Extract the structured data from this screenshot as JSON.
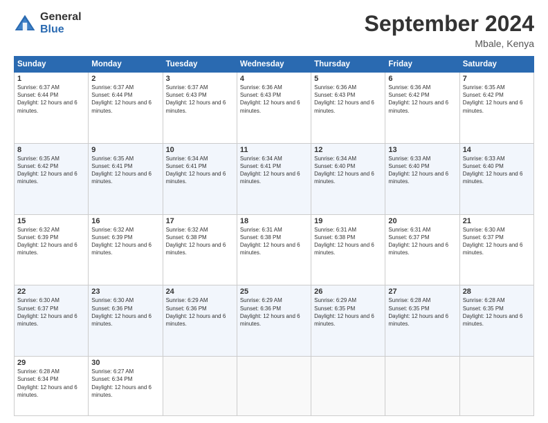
{
  "header": {
    "logo_general": "General",
    "logo_blue": "Blue",
    "month_title": "September 2024",
    "location": "Mbale, Kenya"
  },
  "days_of_week": [
    "Sunday",
    "Monday",
    "Tuesday",
    "Wednesday",
    "Thursday",
    "Friday",
    "Saturday"
  ],
  "weeks": [
    [
      {
        "day": "1",
        "sunrise": "6:37 AM",
        "sunset": "6:44 PM",
        "daylight": "12 hours and 6 minutes."
      },
      {
        "day": "2",
        "sunrise": "6:37 AM",
        "sunset": "6:44 PM",
        "daylight": "12 hours and 6 minutes."
      },
      {
        "day": "3",
        "sunrise": "6:37 AM",
        "sunset": "6:43 PM",
        "daylight": "12 hours and 6 minutes."
      },
      {
        "day": "4",
        "sunrise": "6:36 AM",
        "sunset": "6:43 PM",
        "daylight": "12 hours and 6 minutes."
      },
      {
        "day": "5",
        "sunrise": "6:36 AM",
        "sunset": "6:43 PM",
        "daylight": "12 hours and 6 minutes."
      },
      {
        "day": "6",
        "sunrise": "6:36 AM",
        "sunset": "6:42 PM",
        "daylight": "12 hours and 6 minutes."
      },
      {
        "day": "7",
        "sunrise": "6:35 AM",
        "sunset": "6:42 PM",
        "daylight": "12 hours and 6 minutes."
      }
    ],
    [
      {
        "day": "8",
        "sunrise": "6:35 AM",
        "sunset": "6:42 PM",
        "daylight": "12 hours and 6 minutes."
      },
      {
        "day": "9",
        "sunrise": "6:35 AM",
        "sunset": "6:41 PM",
        "daylight": "12 hours and 6 minutes."
      },
      {
        "day": "10",
        "sunrise": "6:34 AM",
        "sunset": "6:41 PM",
        "daylight": "12 hours and 6 minutes."
      },
      {
        "day": "11",
        "sunrise": "6:34 AM",
        "sunset": "6:41 PM",
        "daylight": "12 hours and 6 minutes."
      },
      {
        "day": "12",
        "sunrise": "6:34 AM",
        "sunset": "6:40 PM",
        "daylight": "12 hours and 6 minutes."
      },
      {
        "day": "13",
        "sunrise": "6:33 AM",
        "sunset": "6:40 PM",
        "daylight": "12 hours and 6 minutes."
      },
      {
        "day": "14",
        "sunrise": "6:33 AM",
        "sunset": "6:40 PM",
        "daylight": "12 hours and 6 minutes."
      }
    ],
    [
      {
        "day": "15",
        "sunrise": "6:32 AM",
        "sunset": "6:39 PM",
        "daylight": "12 hours and 6 minutes."
      },
      {
        "day": "16",
        "sunrise": "6:32 AM",
        "sunset": "6:39 PM",
        "daylight": "12 hours and 6 minutes."
      },
      {
        "day": "17",
        "sunrise": "6:32 AM",
        "sunset": "6:38 PM",
        "daylight": "12 hours and 6 minutes."
      },
      {
        "day": "18",
        "sunrise": "6:31 AM",
        "sunset": "6:38 PM",
        "daylight": "12 hours and 6 minutes."
      },
      {
        "day": "19",
        "sunrise": "6:31 AM",
        "sunset": "6:38 PM",
        "daylight": "12 hours and 6 minutes."
      },
      {
        "day": "20",
        "sunrise": "6:31 AM",
        "sunset": "6:37 PM",
        "daylight": "12 hours and 6 minutes."
      },
      {
        "day": "21",
        "sunrise": "6:30 AM",
        "sunset": "6:37 PM",
        "daylight": "12 hours and 6 minutes."
      }
    ],
    [
      {
        "day": "22",
        "sunrise": "6:30 AM",
        "sunset": "6:37 PM",
        "daylight": "12 hours and 6 minutes."
      },
      {
        "day": "23",
        "sunrise": "6:30 AM",
        "sunset": "6:36 PM",
        "daylight": "12 hours and 6 minutes."
      },
      {
        "day": "24",
        "sunrise": "6:29 AM",
        "sunset": "6:36 PM",
        "daylight": "12 hours and 6 minutes."
      },
      {
        "day": "25",
        "sunrise": "6:29 AM",
        "sunset": "6:36 PM",
        "daylight": "12 hours and 6 minutes."
      },
      {
        "day": "26",
        "sunrise": "6:29 AM",
        "sunset": "6:35 PM",
        "daylight": "12 hours and 6 minutes."
      },
      {
        "day": "27",
        "sunrise": "6:28 AM",
        "sunset": "6:35 PM",
        "daylight": "12 hours and 6 minutes."
      },
      {
        "day": "28",
        "sunrise": "6:28 AM",
        "sunset": "6:35 PM",
        "daylight": "12 hours and 6 minutes."
      }
    ],
    [
      {
        "day": "29",
        "sunrise": "6:28 AM",
        "sunset": "6:34 PM",
        "daylight": "12 hours and 6 minutes."
      },
      {
        "day": "30",
        "sunrise": "6:27 AM",
        "sunset": "6:34 PM",
        "daylight": "12 hours and 6 minutes."
      },
      null,
      null,
      null,
      null,
      null
    ]
  ]
}
